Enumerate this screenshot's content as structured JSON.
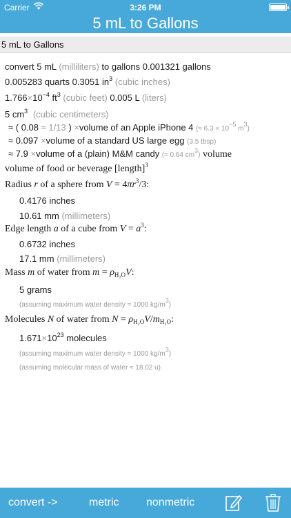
{
  "status_bar": {
    "carrier": "Carrier",
    "time": "3:26 PM",
    "wifi_icon": "wifi-icon",
    "battery_icon": "battery-icon"
  },
  "header": {
    "title": "5 mL to Gallons"
  },
  "query": {
    "text": "5 mL to Gallons"
  },
  "result": {
    "convert_word": "convert",
    "input_value": "5 mL",
    "input_unit": "(milliliters)",
    "to_gallons": "to gallons",
    "gallons_value": "0.001321 gallons",
    "quarts_value": "0.005283 quarts",
    "cubic_inches_value": "0.3051 in",
    "cubic_inches_unit": "(cubic inches)",
    "cubic_feet_mantissa": "1.766",
    "times": "×",
    "ten": "10",
    "cubic_feet_exp": "−4",
    "cubic_feet_unit_symbol": "ft",
    "cubic_feet_unit": "(cubic feet)",
    "liters_value": "0.005 L",
    "liters_unit": "(liters)",
    "cm3_value": "5 cm",
    "cm3_unit": "(cubic centimeters)"
  },
  "comparisons": [
    {
      "approx": "≈",
      "value_prefix": "( 0.08",
      "approx_small": "≈",
      "frac": "1/13",
      "value_suffix": ")",
      "times": "×",
      "text": "volume of an Apple iPhone 4",
      "note_open": "(≈ 6.3 × 10",
      "note_exp": "−5",
      "note_unit": " m",
      "note_close": ")"
    },
    {
      "approx": "≈",
      "value": "0.097",
      "times": "×",
      "text": "volume of a standard US large egg",
      "note": "(3.5 tbsp)"
    },
    {
      "approx": "≈",
      "value": "7.9",
      "times": "×",
      "text": "volume of a (plain) M&M candy",
      "note": "(≈ 0.64 cm",
      "note_close": ")",
      "suffix": "volume"
    }
  ],
  "food_line": {
    "text": "volume of food or beverage [length]"
  },
  "sphere": {
    "label": "Radius",
    "var": "r",
    "mid": "of a sphere from",
    "formula_lhs": "V",
    "formula_eq": " = 4",
    "formula_pi": "π",
    "formula_r": "r",
    "formula_tail": "/3:",
    "inches": "0.4176 inches",
    "mm_value": "10.61 mm",
    "mm_unit": "(millimeters)"
  },
  "cube": {
    "label": "Edge length",
    "var": "a",
    "mid": "of a cube from",
    "formula_lhs": "V",
    "formula_eq": " = ",
    "formula_a": "a",
    "formula_tail": ":",
    "inches": "0.6732 inches",
    "mm_value": "17.1 mm",
    "mm_unit": "(millimeters)"
  },
  "mass": {
    "label": "Mass",
    "var": "m",
    "mid": "of water from",
    "formula_lhs": "m",
    "formula_eq": " = ",
    "rho": "ρ",
    "h2o_sub": "H₂O",
    "formula_v": "V",
    "formula_tail": ":",
    "value": "5 grams",
    "assumption": "(assuming maximum water density ≈ 1000 kg/m",
    "assumption_close": ")"
  },
  "molecules": {
    "label": "Molecules",
    "var": "N",
    "mid": "of water from",
    "formula_lhs": "N",
    "formula_eq": " = ",
    "rho": "ρ",
    "h2o_sub": "H₂O",
    "formula_v": "V",
    "slash": "/",
    "m": "m",
    "formula_tail": ":",
    "mantissa": "1.671",
    "times": "×",
    "ten": "10",
    "exp": "23",
    "unit": "molecules",
    "assumption1": "(assuming maximum water density ≈ 1000 kg/m",
    "assumption1_close": ")",
    "assumption2": "(assuming molecular mass of water ≈ 18.02 u)"
  },
  "toolbar": {
    "convert_label": "convert ->",
    "metric_label": "metric",
    "nonmetric_label": "nonmetric",
    "edit_icon": "edit-icon",
    "trash_icon": "trash-icon"
  }
}
